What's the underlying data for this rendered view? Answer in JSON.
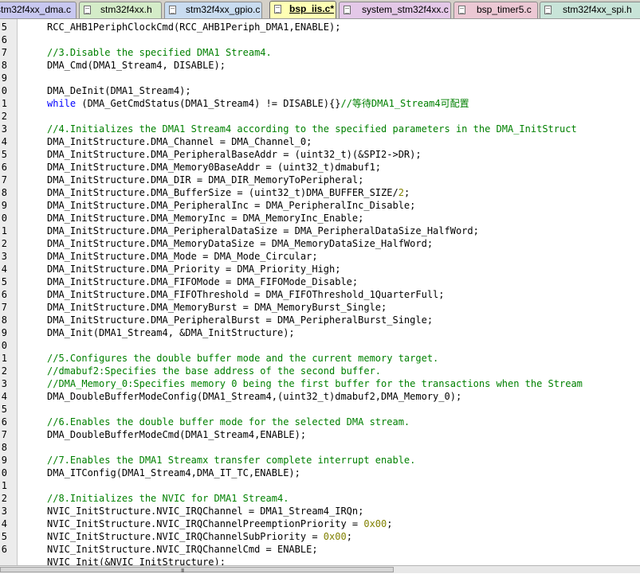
{
  "tabs": [
    {
      "label": "stm32f4xx_dma.c",
      "active": false
    },
    {
      "label": "stm32f4xx.h",
      "active": false
    },
    {
      "label": "stm32f4xx_gpio.c",
      "active": false
    },
    {
      "label": "bsp_iis.c*",
      "active": true
    },
    {
      "label": "system_stm32f4xx.c",
      "active": false
    },
    {
      "label": "bsp_timer5.c",
      "active": false
    },
    {
      "label": "stm32f4xx_spi.h",
      "active": false
    }
  ],
  "tab_colors": [
    "#c8c8f0",
    "#d4ecc8",
    "#c9dcf0",
    "#ffffb4",
    "#e4c8e8",
    "#ecc8d4",
    "#c8e4d8"
  ],
  "line_numbers": [
    "5",
    "6",
    "7",
    "8",
    "9",
    "0",
    "1",
    "2",
    "3",
    "4",
    "5",
    "6",
    "7",
    "8",
    "9",
    "0",
    "1",
    "2",
    "3",
    "4",
    "5",
    "6",
    "7",
    "8",
    "9",
    "0",
    "1",
    "2",
    "3",
    "4",
    "5",
    "6",
    "7",
    "8",
    "9",
    "0",
    "1",
    "2",
    "3",
    "4",
    "5",
    "6"
  ],
  "code_lines": [
    [
      {
        "t": "RCC_AHB1PeriphClockCmd(RCC_AHB1Periph_DMA1,ENABLE);",
        "c": ""
      }
    ],
    [],
    [
      {
        "t": "//3.Disable the specified DMA1 Stream4.",
        "c": "cm"
      }
    ],
    [
      {
        "t": "DMA_Cmd(DMA1_Stream4, DISABLE);",
        "c": ""
      }
    ],
    [],
    [
      {
        "t": "DMA_DeInit(DMA1_Stream4);",
        "c": ""
      }
    ],
    [
      {
        "t": "while",
        "c": "kw"
      },
      {
        "t": " (DMA_GetCmdStatus(DMA1_Stream4) != DISABLE){}",
        "c": ""
      },
      {
        "t": "//等待DMA1_Stream4可配置",
        "c": "cm"
      }
    ],
    [],
    [
      {
        "t": "//4.Initializes the DMA1 Stream4 according to the specified parameters in the DMA_InitStruct",
        "c": "cm"
      }
    ],
    [
      {
        "t": "DMA_InitStructure.DMA_Channel = DMA_Channel_0;",
        "c": ""
      }
    ],
    [
      {
        "t": "DMA_InitStructure.DMA_PeripheralBaseAddr = (uint32_t)(&SPI2->DR);",
        "c": ""
      }
    ],
    [
      {
        "t": "DMA_InitStructure.DMA_Memory0BaseAddr = (uint32_t)dmabuf1;",
        "c": ""
      }
    ],
    [
      {
        "t": "DMA_InitStructure.DMA_DIR = DMA_DIR_MemoryToPeripheral;",
        "c": ""
      }
    ],
    [
      {
        "t": "DMA_InitStructure.DMA_BufferSize = (uint32_t)DMA_BUFFER_SIZE/",
        "c": ""
      },
      {
        "t": "2",
        "c": "num"
      },
      {
        "t": ";",
        "c": ""
      }
    ],
    [
      {
        "t": "DMA_InitStructure.DMA_PeripheralInc = DMA_PeripheralInc_Disable;",
        "c": ""
      }
    ],
    [
      {
        "t": "DMA_InitStructure.DMA_MemoryInc = DMA_MemoryInc_Enable;",
        "c": ""
      }
    ],
    [
      {
        "t": "DMA_InitStructure.DMA_PeripheralDataSize = DMA_PeripheralDataSize_HalfWord;",
        "c": ""
      }
    ],
    [
      {
        "t": "DMA_InitStructure.DMA_MemoryDataSize = DMA_MemoryDataSize_HalfWord;",
        "c": ""
      }
    ],
    [
      {
        "t": "DMA_InitStructure.DMA_Mode = DMA_Mode_Circular;",
        "c": ""
      }
    ],
    [
      {
        "t": "DMA_InitStructure.DMA_Priority = DMA_Priority_High;",
        "c": ""
      }
    ],
    [
      {
        "t": "DMA_InitStructure.DMA_FIFOMode = DMA_FIFOMode_Disable;",
        "c": ""
      }
    ],
    [
      {
        "t": "DMA_InitStructure.DMA_FIFOThreshold = DMA_FIFOThreshold_1QuarterFull;",
        "c": ""
      }
    ],
    [
      {
        "t": "DMA_InitStructure.DMA_MemoryBurst = DMA_MemoryBurst_Single;",
        "c": ""
      }
    ],
    [
      {
        "t": "DMA_InitStructure.DMA_PeripheralBurst = DMA_PeripheralBurst_Single;",
        "c": ""
      }
    ],
    [
      {
        "t": "DMA_Init(DMA1_Stream4, &DMA_InitStructure);",
        "c": ""
      }
    ],
    [],
    [
      {
        "t": "//5.Configures the double buffer mode and the current memory target.",
        "c": "cm"
      }
    ],
    [
      {
        "t": "//dmabuf2:Specifies the base address of the second buffer.",
        "c": "cm"
      }
    ],
    [
      {
        "t": "//DMA_Memory_0:Specifies memory 0 being the first buffer for the transactions when the Stream",
        "c": "cm"
      }
    ],
    [
      {
        "t": "DMA_DoubleBufferModeConfig(DMA1_Stream4,(uint32_t)dmabuf2,DMA_Memory_0);",
        "c": ""
      }
    ],
    [],
    [
      {
        "t": "//6.Enables the double buffer mode for the selected DMA stream.",
        "c": "cm"
      }
    ],
    [
      {
        "t": "DMA_DoubleBufferModeCmd(DMA1_Stream4,ENABLE);",
        "c": ""
      }
    ],
    [],
    [
      {
        "t": "//7.Enables the DMA1 Streamx transfer complete interrupt enable.",
        "c": "cm"
      }
    ],
    [
      {
        "t": "DMA_ITConfig(DMA1_Stream4,DMA_IT_TC,ENABLE);",
        "c": ""
      }
    ],
    [],
    [
      {
        "t": "//8.Initializes the NVIC for DMA1 Stream4.",
        "c": "cm"
      }
    ],
    [
      {
        "t": "NVIC_InitStructure.NVIC_IRQChannel = DMA1_Stream4_IRQn;",
        "c": ""
      }
    ],
    [
      {
        "t": "NVIC_InitStructure.NVIC_IRQChannelPreemptionPriority = ",
        "c": ""
      },
      {
        "t": "0x00",
        "c": "num"
      },
      {
        "t": ";",
        "c": ""
      }
    ],
    [
      {
        "t": "NVIC_InitStructure.NVIC_IRQChannelSubPriority = ",
        "c": ""
      },
      {
        "t": "0x00",
        "c": "num"
      },
      {
        "t": ";",
        "c": ""
      }
    ],
    [
      {
        "t": "NVIC_InitStructure.NVIC_IRQChannelCmd = ENABLE;",
        "c": ""
      }
    ],
    [
      {
        "t": "NVIC_Init(&NVIC_InitStructure);",
        "c": ""
      }
    ]
  ],
  "scrollbar_grip": "III"
}
